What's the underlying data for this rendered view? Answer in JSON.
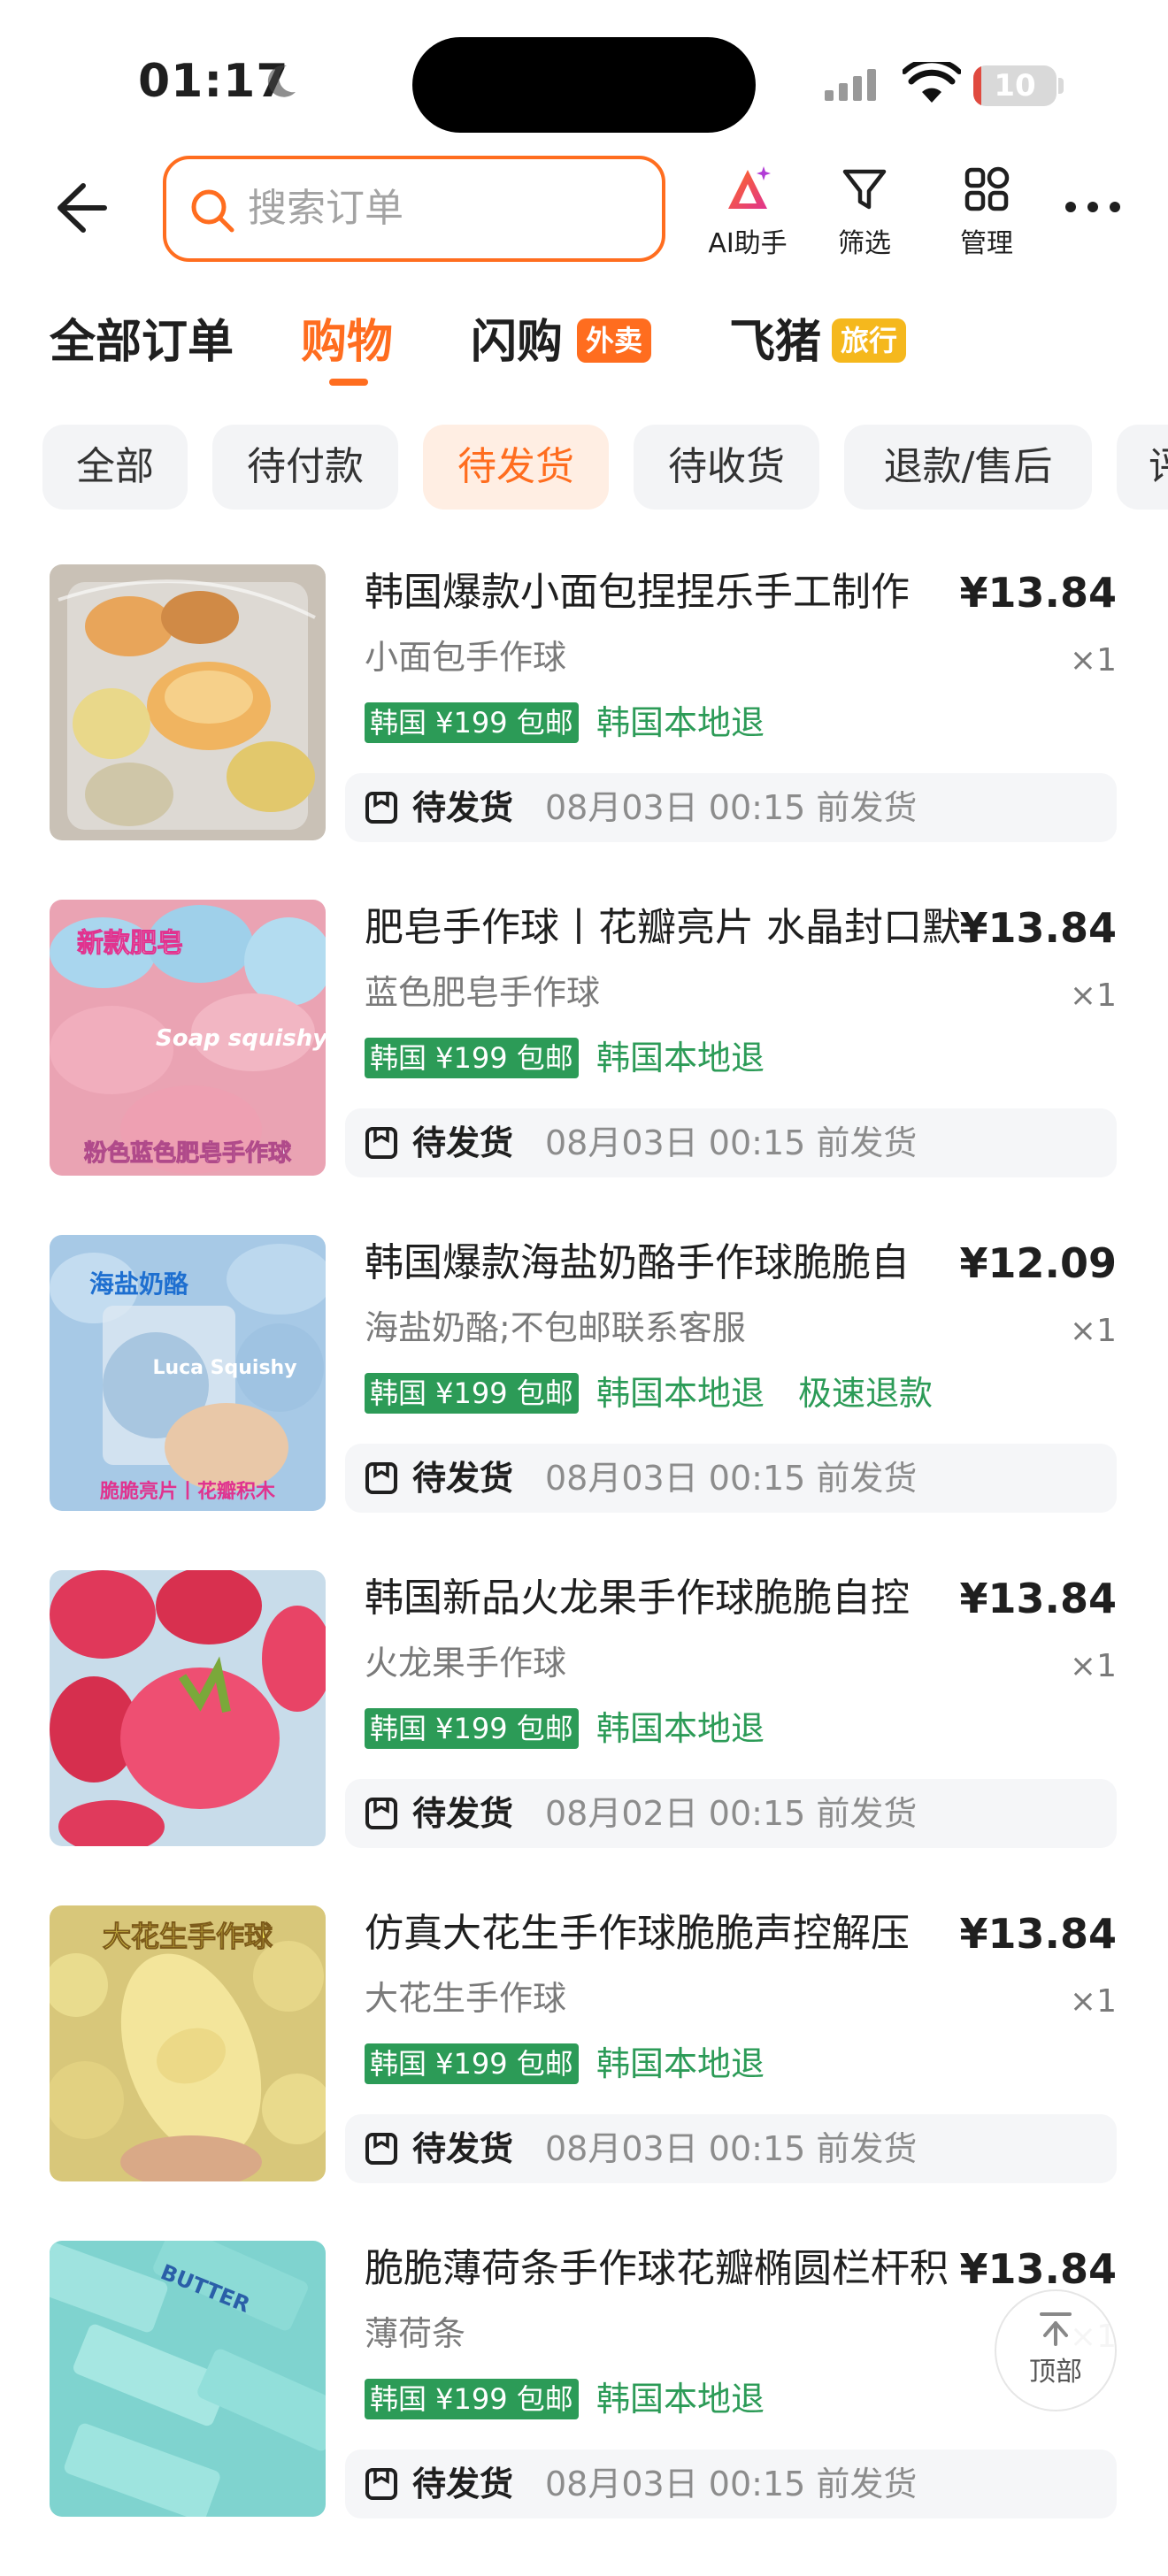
{
  "status_bar": {
    "time": "01:17",
    "battery": "10",
    "battery_level": 0.1
  },
  "header": {
    "search_placeholder": "搜索订单",
    "tools": [
      {
        "label": "AI助手",
        "icon": "ai-assistant-icon"
      },
      {
        "label": "筛选",
        "icon": "filter-icon"
      },
      {
        "label": "管理",
        "icon": "grid-manage-icon"
      }
    ],
    "more_icon": "more-dots-icon"
  },
  "tabs": [
    {
      "label": "全部订单",
      "active": false
    },
    {
      "label": "购物",
      "active": true
    },
    {
      "label": "闪购",
      "badge": "外卖",
      "active": false
    },
    {
      "label": "飞猪",
      "badge": "旅行",
      "active": false
    }
  ],
  "filters": [
    "全部",
    "待付款",
    "待发货",
    "待收货",
    "退款/售后",
    "评"
  ],
  "active_filter": "待发货",
  "orders": [
    {
      "title": "韩国爆款小面包捏捏乐手工制作",
      "price": "¥13.84",
      "variant": "小面包手作球",
      "qty": "×1",
      "promo": "韩国 ¥199 包邮",
      "tags": [
        "韩国本地退"
      ],
      "status": "待发货",
      "ship_by": "08月03日 00:15 前发货"
    },
    {
      "title": "肥皂手作球丨花瓣亮片 水晶封口默",
      "price": "¥13.84",
      "variant": "蓝色肥皂手作球",
      "qty": "×1",
      "promo": "韩国 ¥199 包邮",
      "tags": [
        "韩国本地退"
      ],
      "status": "待发货",
      "ship_by": "08月03日 00:15 前发货",
      "image_text": [
        "新款肥皂",
        "Soap squishy",
        "粉色蓝色肥皂手作球"
      ]
    },
    {
      "title": "韩国爆款海盐奶酪手作球脆脆自",
      "price": "¥12.09",
      "variant": "海盐奶酪;不包邮联系客服",
      "qty": "×1",
      "promo": "韩国 ¥199 包邮",
      "tags": [
        "韩国本地退",
        "极速退款"
      ],
      "status": "待发货",
      "ship_by": "08月03日 00:15 前发货",
      "image_text": [
        "海盐奶酪",
        "Luca Squishy",
        "脆脆亮片丨花瓣积木"
      ]
    },
    {
      "title": "韩国新品火龙果手作球脆脆自控",
      "price": "¥13.84",
      "variant": "火龙果手作球",
      "qty": "×1",
      "promo": "韩国 ¥199 包邮",
      "tags": [
        "韩国本地退"
      ],
      "status": "待发货",
      "ship_by": "08月02日 00:15 前发货"
    },
    {
      "title": "仿真大花生手作球脆脆声控解压",
      "price": "¥13.84",
      "variant": "大花生手作球",
      "qty": "×1",
      "promo": "韩国 ¥199 包邮",
      "tags": [
        "韩国本地退"
      ],
      "status": "待发货",
      "ship_by": "08月03日 00:15 前发货",
      "image_text": [
        "大花生手作球"
      ]
    },
    {
      "title": "脆脆薄荷条手作球花瓣椭圆栏杆积",
      "price": "¥13.84",
      "variant": "薄荷条",
      "qty": "×1",
      "promo": "韩国 ¥199 包邮",
      "tags": [
        "韩国本地退"
      ],
      "status": "待发货",
      "ship_by": "08月03日 00:15 前发货",
      "image_text": [
        "BUTTER"
      ]
    }
  ],
  "back_to_top": "顶部",
  "colors": {
    "accent": "#ff6d1f",
    "green": "#2c9b57",
    "badge_yellow": "#f5b81d"
  }
}
